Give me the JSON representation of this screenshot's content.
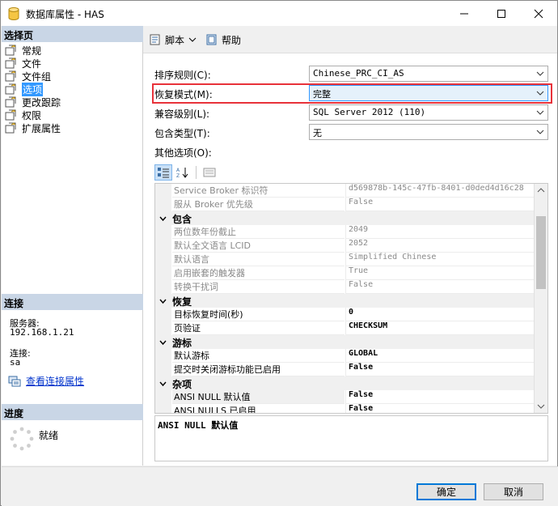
{
  "window": {
    "title": "数据库属性 - HAS"
  },
  "left": {
    "select_page_header": "选择页",
    "pages": [
      "常规",
      "文件",
      "文件组",
      "选项",
      "更改跟踪",
      "权限",
      "扩展属性"
    ],
    "selected_index": 3,
    "connection_header": "连接",
    "server_label": "服务器:",
    "server_value": "192.168.1.21",
    "connection_label": "连接:",
    "connection_value": "sa",
    "view_conn_link": "查看连接属性",
    "progress_header": "进度",
    "progress_status": "就绪"
  },
  "toolbar": {
    "script_label": "脚本",
    "help_label": "帮助"
  },
  "fields": {
    "collation_label": "排序规则(C):",
    "collation_value": "Chinese_PRC_CI_AS",
    "recovery_label": "恢复模式(M):",
    "recovery_value": "完整",
    "compat_label": "兼容级别(L):",
    "compat_value": "SQL Server 2012 (110)",
    "containment_label": "包含类型(T):",
    "containment_value": "无",
    "other_label": "其他选项(O):"
  },
  "grid": {
    "rows": [
      {
        "kind": "prop",
        "name": "Service Broker 标识符",
        "value": "d569878b-145c-47fb-8401-d0ded4d16c28",
        "readonly": true
      },
      {
        "kind": "prop",
        "name": "服从 Broker 优先级",
        "value": "False",
        "readonly": true
      },
      {
        "kind": "cat",
        "name": "包含"
      },
      {
        "kind": "prop",
        "name": "两位数年份截止",
        "value": "2049",
        "readonly": true
      },
      {
        "kind": "prop",
        "name": "默认全文语言 LCID",
        "value": "2052",
        "readonly": true
      },
      {
        "kind": "prop",
        "name": "默认语言",
        "value": "Simplified Chinese",
        "readonly": true
      },
      {
        "kind": "prop",
        "name": "启用嵌套的触发器",
        "value": "True",
        "readonly": true
      },
      {
        "kind": "prop",
        "name": "转换干扰词",
        "value": "False",
        "readonly": true
      },
      {
        "kind": "cat",
        "name": "恢复"
      },
      {
        "kind": "prop",
        "name": "目标恢复时间(秒)",
        "value": "0",
        "readonly": false
      },
      {
        "kind": "prop",
        "name": "页验证",
        "value": "CHECKSUM",
        "readonly": false
      },
      {
        "kind": "cat",
        "name": "游标"
      },
      {
        "kind": "prop",
        "name": "默认游标",
        "value": "GLOBAL",
        "readonly": false
      },
      {
        "kind": "prop",
        "name": "提交时关闭游标功能已启用",
        "value": "False",
        "readonly": false
      },
      {
        "kind": "cat",
        "name": "杂项"
      },
      {
        "kind": "prop",
        "name": "ANSI NULL 默认值",
        "value": "False",
        "readonly": false,
        "selected": true
      },
      {
        "kind": "prop",
        "name": "ANSI NULLS 已启用",
        "value": "False",
        "readonly": false
      }
    ]
  },
  "description": "ANSI NULL 默认值",
  "footer": {
    "ok_label": "确定",
    "cancel_label": "取消"
  },
  "colors": {
    "accent": "#3399ff",
    "highlight_box": "#e8323a",
    "section_header": "#c9d6e6"
  },
  "icons": [
    "database-icon",
    "minimize-icon",
    "maximize-icon",
    "close-icon",
    "page-icon",
    "script-icon",
    "help-icon",
    "categorized-icon",
    "alphabetical-icon",
    "property-pages-icon",
    "connection-icon",
    "spinner-icon",
    "chevron-down-icon"
  ]
}
